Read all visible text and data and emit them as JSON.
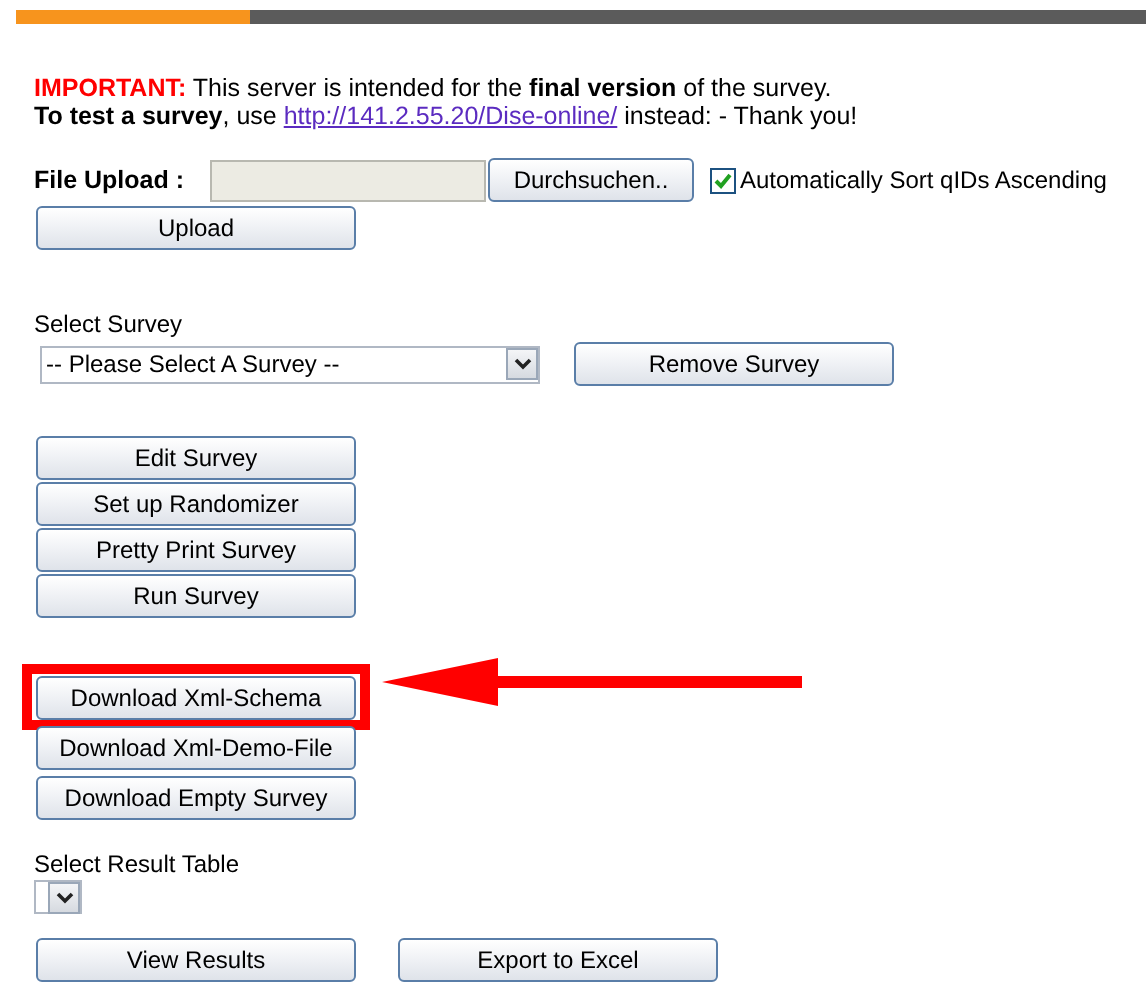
{
  "notice": {
    "label": "IMPORTANT:",
    "line_1": "This server is intended for the **final version** of the survey.",
    "line_2_start": "**To test a survey**, use",
    "link": "http://141.2.55.20/Dise-online/",
    "line_2_end": "instead: - Thank you!"
  },
  "upload": {
    "label": "File Upload :",
    "browse_button": "Durchsuchen..",
    "sort_checkbox": {
      "label": "Automatically Sort qIDs Ascending",
      "checked": true
    },
    "upload_button": "Upload"
  },
  "survey_select": {
    "label": "Select Survey",
    "value": "-- Please Select A Survey --",
    "remove_button": "Remove Survey"
  },
  "survey_actions": [
    "Edit Survey",
    "Set up Randomizer",
    "Pretty Print Survey",
    "Run Survey"
  ],
  "downloads": [
    {
      "label": "Download Xml-Schema",
      "highlighted": true
    },
    {
      "label": "Download Xml-Demo-File",
      "highlighted": false
    },
    {
      "label": "Download Empty Survey",
      "highlighted": false
    }
  ],
  "result_select": {
    "label": "Select Result Table"
  },
  "result_buttons": [
    "View Results",
    "Export to Excel"
  ]
}
